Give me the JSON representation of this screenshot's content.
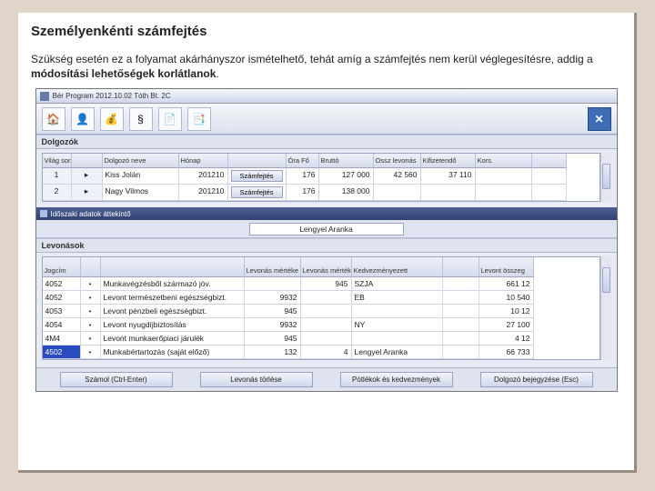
{
  "title": "Személyenkénti számfejtés",
  "desc_part1": "Szükség esetén ez a folyamat akárhányszor ismételhető, tehát amíg a számfejtés nem kerül véglegesítésre, addig a ",
  "desc_bold": "módosítási lehetőségek korlátlanok",
  "desc_part2": ".",
  "window1": {
    "title": "Bér Program 2012.10.02 Tóth Bt. 2C",
    "section": "Dolgozók",
    "columns": [
      "Világ sorsz.",
      "",
      "Dolgozó neve",
      "Hónap",
      "",
      "Óra Fő",
      "Bruttó",
      "Ossz levonás",
      "Kifizetendő",
      "Kors."
    ],
    "rows": [
      {
        "sor": "1",
        "name": "Kiss Jolán",
        "honap": "201210",
        "btn": "Számfejtés",
        "ora": "176",
        "brutto": "127 000",
        "lev": "42 560",
        "kif": "37 110",
        "kor": ""
      },
      {
        "sor": "2",
        "name": "Nagy Vilmos",
        "honap": "201210",
        "btn": "Számfejtés",
        "ora": "176",
        "brutto": "138 000",
        "lev": "",
        "kif": "",
        "kor": ""
      }
    ]
  },
  "window2": {
    "title": "Időszaki adatok áttekintő",
    "name_value": "Lengyel Aranka",
    "section": "Levonások",
    "columns": [
      "Jogcím",
      "",
      "",
      "Levonás mértéke (Ft)",
      "Levonás mértéke (%)",
      "Kedvezményezett",
      "",
      "Levont összeg"
    ],
    "rows": [
      {
        "code": "4052",
        "desc": "Munkavégzésből származó jöv.",
        "mFt": "",
        "mPc": "945",
        "kedv": "SZJA",
        "lev": "661 12"
      },
      {
        "code": "4052",
        "desc": "Levont természetbeni egészségbizt.",
        "mFt": "9932",
        "mPc": "",
        "kedv": "EB",
        "lev": "10 540"
      },
      {
        "code": "4053",
        "desc": "Levont pénzbeli egészségbizt.",
        "mFt": "945",
        "mPc": "",
        "kedv": "",
        "lev": "10 12"
      },
      {
        "code": "4054",
        "desc": "Levont nyugdíjbiztosítás",
        "mFt": "9932",
        "mPc": "",
        "kedv": "NY",
        "lev": "27 100"
      },
      {
        "code": "4M4",
        "desc": "Levont munkaerőpiaci járulék",
        "mFt": "945",
        "mPc": "",
        "kedv": "",
        "lev": "4 12"
      },
      {
        "code": "4502",
        "desc": "Munkabértartozás (saját előző)",
        "mFt": "132",
        "mPc": "4",
        "kedv": "Lengyel Aranka",
        "lev": "66 733"
      }
    ],
    "buttons": [
      "Számol (Ctrl-Enter)",
      "Levonás törlése",
      "Pótlékok és kedvezmények",
      "Dolgozó bejegyzése (Esc)"
    ]
  }
}
